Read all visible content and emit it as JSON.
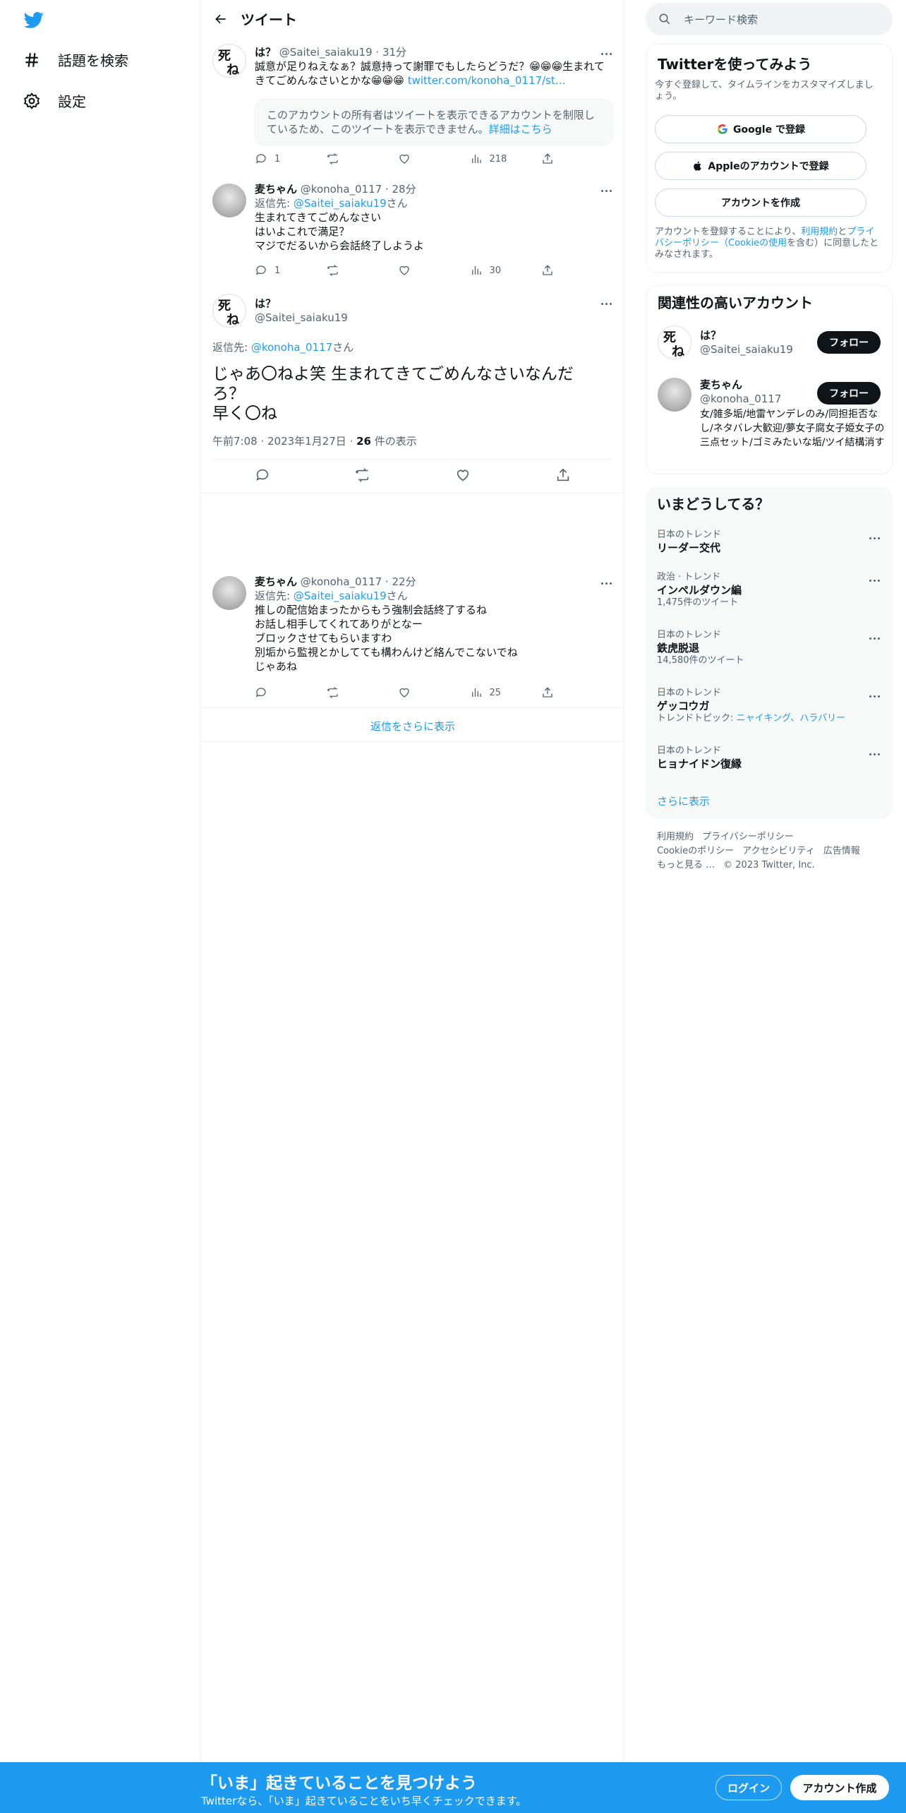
{
  "nav": {
    "explore_label": "話題を検索",
    "settings_label": "設定"
  },
  "header": {
    "title": "ツイート"
  },
  "tweets": [
    {
      "name": "は？",
      "handle": "@Saitei_saiaku19",
      "time": "· 31分",
      "text": "誠意が足りねえなぁ？誠意持って謝罪でもしたらどうだ？😁😁😁生まれてきてごめんなさいとかな😁😁😁",
      "link": "twitter.com/konoha_0117/st…",
      "restricted_text": "このアカウントの所有者はツイートを表示できるアカウントを制限しているため、このツイートを表示できません。",
      "restricted_link": "詳細はこちら",
      "replies": "1",
      "views": "218"
    },
    {
      "name": "麦ちゃん",
      "handle": "@konoha_0117",
      "time": "· 28分",
      "reply_prefix": "返信先: ",
      "reply_handle": "@Saitei_saiaku19",
      "reply_suffix": "さん",
      "text": "生まれてきてごめんなさい\nはいよこれで満足？\nマジでだるいから会話終了しようよ",
      "replies": "1",
      "views": "30"
    }
  ],
  "main_tweet": {
    "name": "は？",
    "handle": "@Saitei_saiaku19",
    "reply_prefix": "返信先: ",
    "reply_handle": "@konoha_0117",
    "reply_suffix": "さん",
    "text": "じゃあ〇ねよ笑 生まれてきてごめんなさいなんだろ？\n早く〇ね",
    "timestamp": "午前7:08 · 2023年1月27日 · ",
    "views_count": "26",
    "views_label": " 件の表示"
  },
  "reply_tweet": {
    "name": "麦ちゃん",
    "handle": "@konoha_0117",
    "time": "· 22分",
    "reply_prefix": "返信先: ",
    "reply_handle": "@Saitei_saiaku19",
    "reply_suffix": "さん",
    "text": "推しの配信始まったからもう強制会話終了するね\nお話し相手してくれてありがとなー\nブロックさせてもらいますわ\n別垢から監視とかしてても構わんけど絡んでこないでね\nじゃあね",
    "views": "25"
  },
  "show_more_replies": "返信をさらに表示",
  "search": {
    "placeholder": "キーワード検索"
  },
  "signup_card": {
    "title": "Twitterを使ってみよう",
    "subtitle": "今すぐ登録して、タイムラインをカスタマイズしましょう。",
    "google_btn": "Google で登録",
    "apple_btn": "Appleのアカウントで登録",
    "create_btn": "アカウントを作成",
    "terms_1": "アカウントを登録することにより、",
    "terms_link1": "利用規約",
    "terms_2": "と",
    "terms_link2": "プライバシーポリシー（Cookieの使用",
    "terms_3": "を含む）に同意したとみなされます。"
  },
  "related": {
    "title": "関連性の高いアカウント",
    "accounts": [
      {
        "name": "は？",
        "handle": "@Saitei_saiaku19",
        "follow": "フォロー"
      },
      {
        "name": "麦ちゃん",
        "handle": "@konoha_0117",
        "follow": "フォロー",
        "bio": "女/雑多垢/地雷ヤンデレのみ/同担拒否なし/ネタバレ大歓迎/夢女子腐女子姫女子の三点セット/ゴミみたいな垢/ツイ結構消す"
      }
    ]
  },
  "trends": {
    "title": "いまどうしてる？",
    "items": [
      {
        "category": "日本のトレンド",
        "name": "リーダー交代"
      },
      {
        "category": "政治 · トレンド",
        "name": "インペルダウン編",
        "count": "1,475件のツイート"
      },
      {
        "category": "日本のトレンド",
        "name": "鉄虎脱退",
        "count": "14,580件のツイート"
      },
      {
        "category": "日本のトレンド",
        "name": "ゲッコウガ",
        "topic_prefix": "トレンドトピック: ",
        "topic_links": "ニャイキング、ハラバリー"
      },
      {
        "category": "日本のトレンド",
        "name": "ヒョナイドン復縁"
      }
    ],
    "show_more": "さらに表示"
  },
  "footer": {
    "links_row1": [
      "利用規約",
      "プライバシーポリシー"
    ],
    "links_row2": [
      "Cookieのポリシー",
      "アクセシビリティ",
      "広告情報"
    ],
    "more": "もっと見る …",
    "copyright": "© 2023 Twitter, Inc."
  },
  "bottom_bar": {
    "headline": "「いま」起きていることを見つけよう",
    "subline": "Twitterなら、「いま」起きていることをいち早くチェックできます。",
    "login": "ログイン",
    "signup": "アカウント作成"
  },
  "colors": {
    "accent": "#1d9bf0",
    "text": "#0f1419",
    "muted": "#536471"
  }
}
